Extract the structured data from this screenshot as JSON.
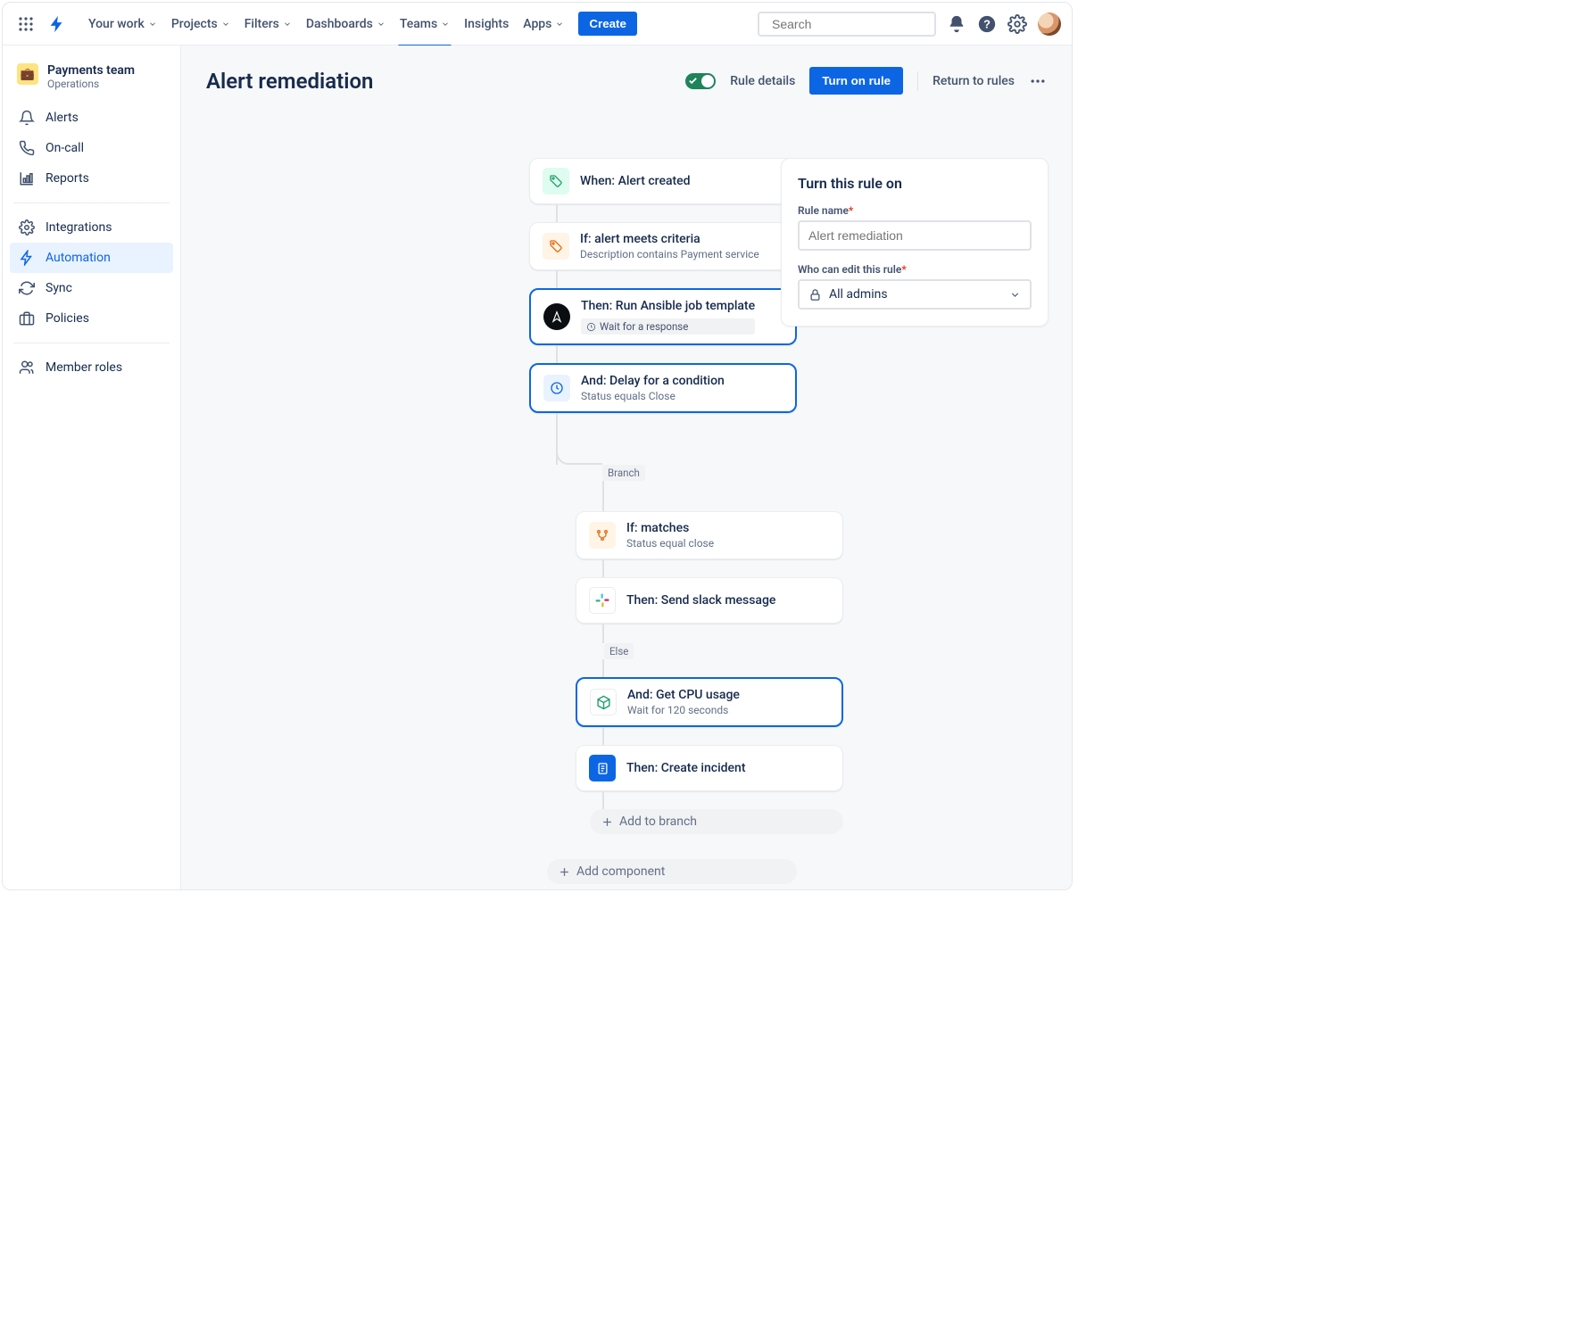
{
  "nav": {
    "items": [
      "Your work",
      "Projects",
      "Filters",
      "Dashboards",
      "Teams",
      "Insights",
      "Apps"
    ],
    "active_index": 4,
    "create": "Create",
    "search_placeholder": "Search"
  },
  "sidebar": {
    "team_name": "Payments team",
    "team_sub": "Operations",
    "groups": [
      {
        "items": [
          {
            "label": "Alerts",
            "icon": "bell"
          },
          {
            "label": "On-call",
            "icon": "phone"
          },
          {
            "label": "Reports",
            "icon": "chart"
          }
        ]
      },
      {
        "items": [
          {
            "label": "Integrations",
            "icon": "gear"
          },
          {
            "label": "Automation",
            "icon": "bolt",
            "active": true
          },
          {
            "label": "Sync",
            "icon": "sync"
          },
          {
            "label": "Policies",
            "icon": "briefcase"
          }
        ]
      },
      {
        "items": [
          {
            "label": "Member roles",
            "icon": "people"
          }
        ]
      }
    ]
  },
  "page": {
    "title": "Alert remediation",
    "rule_details": "Rule details",
    "turn_on": "Turn on rule",
    "return": "Return to rules",
    "toggle_on": true
  },
  "flow": {
    "cards": [
      {
        "title": "When: Alert created",
        "sub": "",
        "icon": "tag-green",
        "selected": false
      },
      {
        "title": "If: alert meets criteria",
        "sub": "Description contains Payment service",
        "icon": "tag-orange",
        "selected": false
      },
      {
        "title": "Then: Run Ansible job template",
        "chip": "Wait for a response",
        "icon": "ansible",
        "selected": true
      },
      {
        "title": "And: Delay for a condition",
        "sub": "Status equals Close",
        "icon": "clock-blue",
        "selected": true
      }
    ],
    "branch_label": "Branch",
    "branch": [
      {
        "title": "If: matches",
        "sub": "Status equal close",
        "icon": "branch-orange",
        "selected": false
      },
      {
        "title": "Then: Send slack message",
        "sub": "",
        "icon": "slack",
        "selected": false
      }
    ],
    "else_label": "Else",
    "else": [
      {
        "title": "And: Get CPU usage",
        "sub": "Wait for 120 seconds",
        "icon": "cube-green",
        "selected": true
      },
      {
        "title": "Then: Create incident",
        "sub": "",
        "icon": "doc-blue",
        "selected": false
      }
    ],
    "add_branch": "Add to branch",
    "add_component": "Add component"
  },
  "panel": {
    "heading": "Turn this rule on",
    "rule_name_label": "Rule name",
    "rule_name_placeholder": "Alert remediation",
    "who_label": "Who can edit this rule",
    "who_value": "All admins"
  }
}
